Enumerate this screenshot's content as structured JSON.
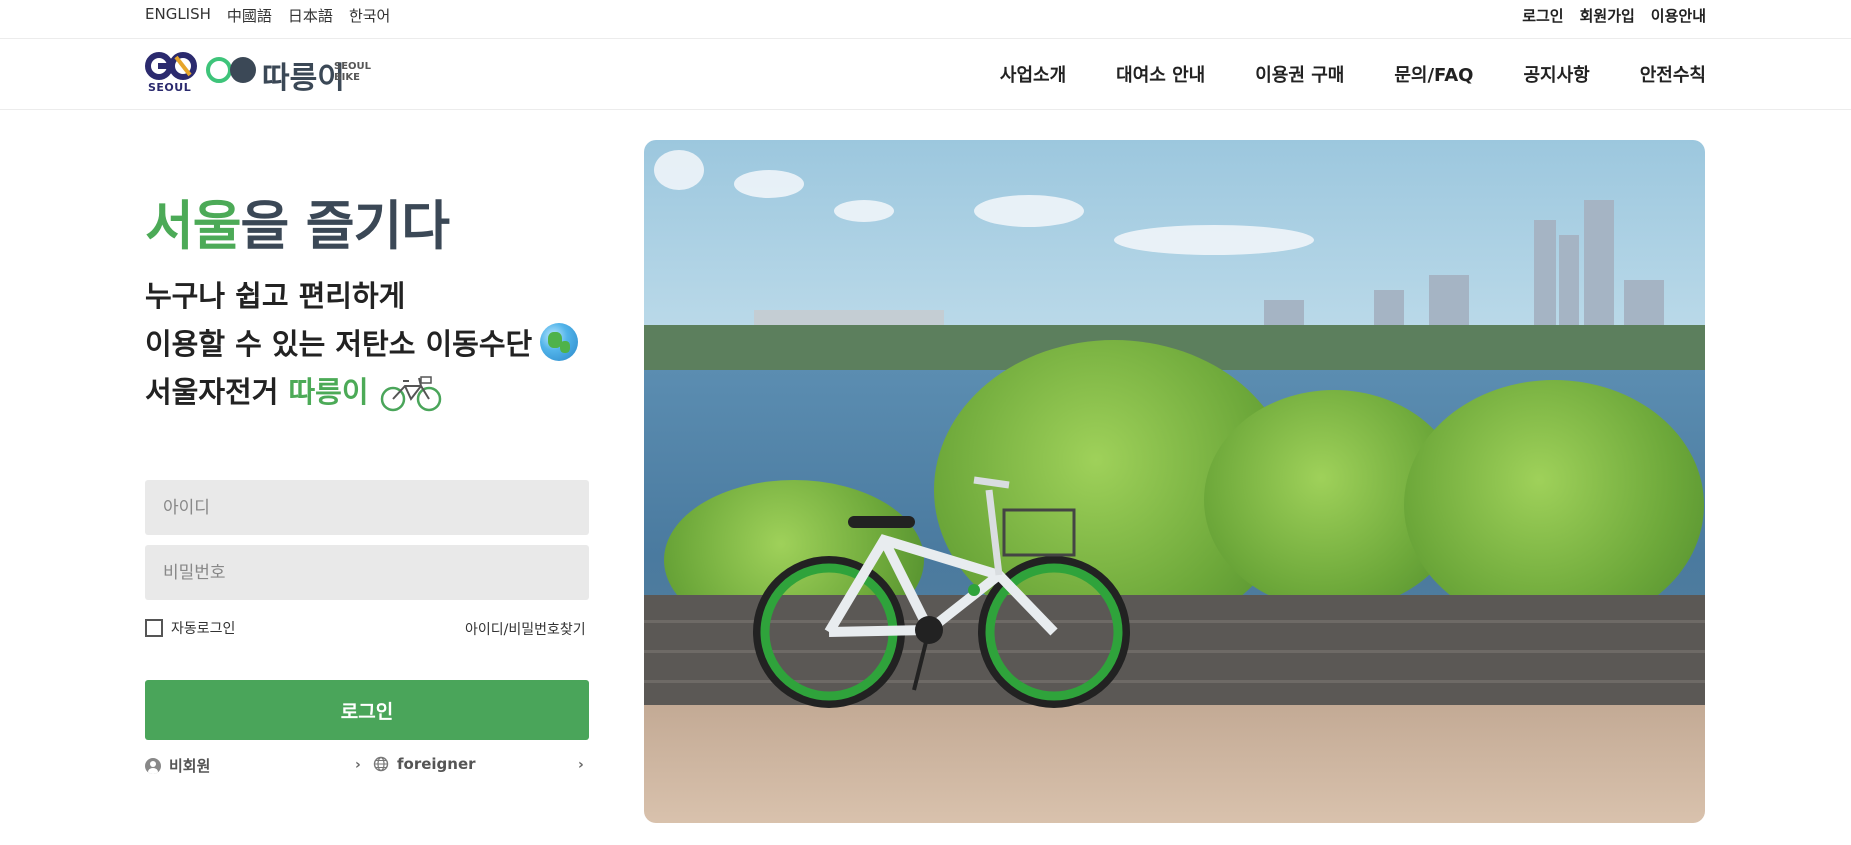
{
  "top_bar": {
    "languages": [
      "ENGLISH",
      "中國語",
      "日本語",
      "한국어"
    ],
    "utility_links": [
      "로그인",
      "회원가입",
      "이용안내"
    ]
  },
  "header": {
    "logo_go_text": "SEOUL",
    "logo_name": "따릉이",
    "logo_sub_line1": "SEOUL",
    "logo_sub_line2": "BIKE",
    "nav": [
      "사업소개",
      "대여소 안내",
      "이용권 구매",
      "문의/FAQ",
      "공지사항",
      "안전수칙"
    ]
  },
  "hero": {
    "title_highlight": "서울",
    "title_rest": "을 즐기다",
    "line1": "누구나 쉽고 편리하게",
    "line2": "이용할 수 있는 저탄소 이동수단",
    "line3_prefix": "서울자전거 ",
    "line3_highlight": "따릉이"
  },
  "login": {
    "id_placeholder": "아이디",
    "pw_placeholder": "비밀번호",
    "auto_login_label": "자동로그인",
    "auto_login_checked": false,
    "find_link": "아이디/비밀번호찾기",
    "login_button": "로그인",
    "nonmember_link": "비회원",
    "foreigner_link": "foreigner",
    "chevron": "›"
  },
  "colors": {
    "brand_green": "#4caa57",
    "button_green": "#4aa55a",
    "navy_text": "#3b4856",
    "input_bg": "#e9e9e9"
  }
}
